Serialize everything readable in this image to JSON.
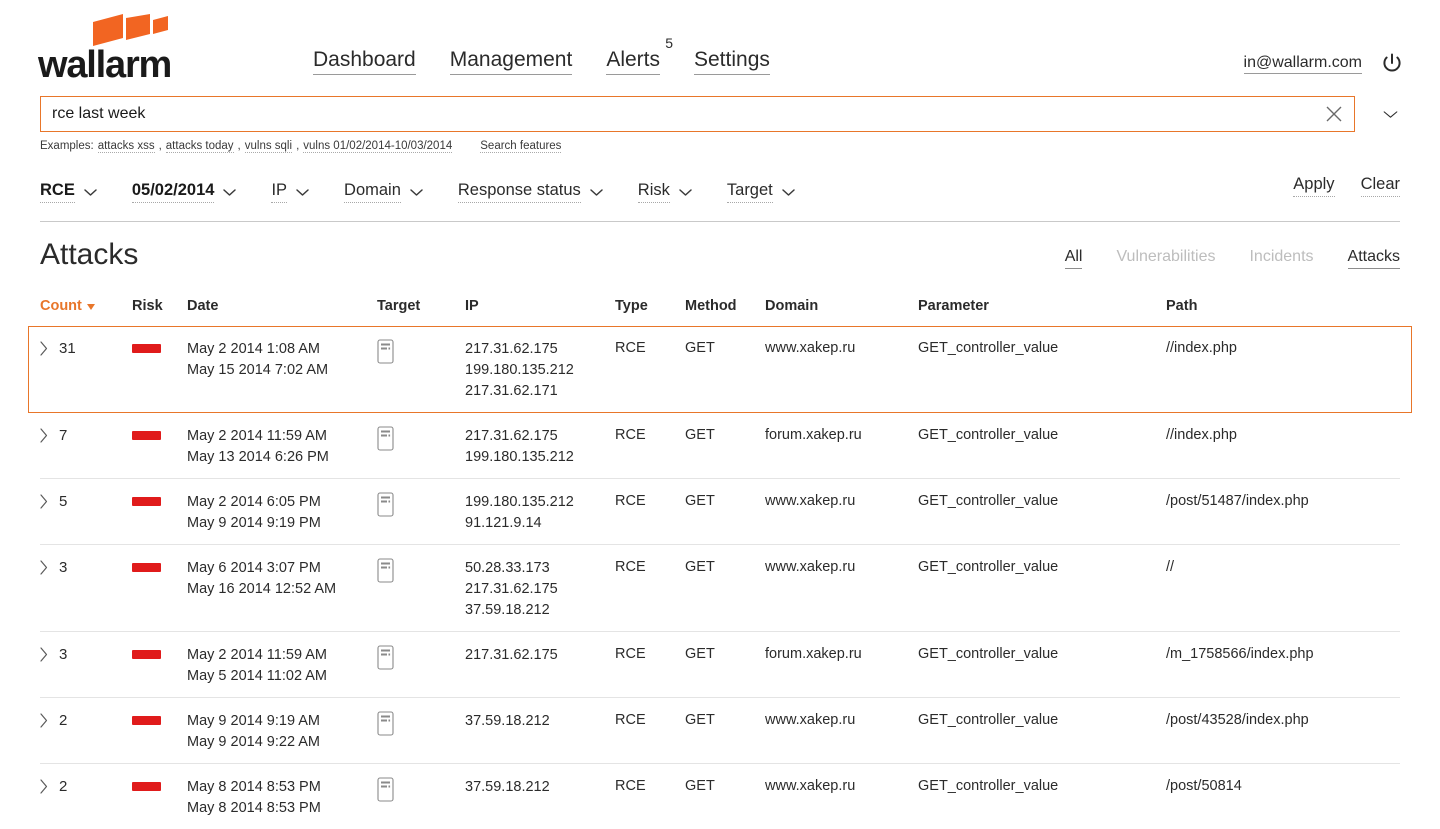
{
  "brand": {
    "name": "wallarm",
    "accent": "#f26522"
  },
  "nav": {
    "items": [
      {
        "label": "Dashboard",
        "badge": ""
      },
      {
        "label": "Management",
        "badge": ""
      },
      {
        "label": "Alerts",
        "badge": "5"
      },
      {
        "label": "Settings",
        "badge": ""
      }
    ]
  },
  "user": {
    "email": "in@wallarm.com",
    "logout_icon": "power-icon"
  },
  "search": {
    "value": "rce last week",
    "placeholder": "",
    "clear_icon": "close-icon",
    "expand_icon": "chevron-down-icon",
    "examples_label": "Examples:",
    "examples": [
      "attacks xss",
      "attacks today",
      "vulns sqli",
      "vulns 01/02/2014-10/03/2014"
    ],
    "features_link": "Search features"
  },
  "filters": {
    "items": [
      {
        "label": "RCE",
        "active": true
      },
      {
        "label": "05/02/2014",
        "active": true
      },
      {
        "label": "IP",
        "active": false
      },
      {
        "label": "Domain",
        "active": false
      },
      {
        "label": "Response status",
        "active": false
      },
      {
        "label": "Risk",
        "active": false
      },
      {
        "label": "Target",
        "active": false
      }
    ],
    "apply_label": "Apply",
    "clear_label": "Clear"
  },
  "section": {
    "title": "Attacks",
    "tabs": [
      {
        "label": "All",
        "state": "active"
      },
      {
        "label": "Vulnerabilities",
        "state": "disabled"
      },
      {
        "label": "Incidents",
        "state": "disabled"
      },
      {
        "label": "Attacks",
        "state": "active"
      }
    ]
  },
  "table": {
    "columns": [
      "Count",
      "Risk",
      "Date",
      "Target",
      "IP",
      "Type",
      "Method",
      "Domain",
      "Parameter",
      "Path"
    ],
    "sort": {
      "column": "Count",
      "direction": "desc",
      "color": "#e8762a"
    },
    "risk_color": "#e01b1b",
    "rows": [
      {
        "count": "31",
        "dates": [
          "May 2 2014 1:08 AM",
          "May 15 2014 7:02 AM"
        ],
        "ips": [
          "217.31.62.175",
          "199.180.135.212",
          "217.31.62.171"
        ],
        "type": "RCE",
        "method": "GET",
        "domain": "www.xakep.ru",
        "parameter": "GET_controller_value",
        "path": "//index.php",
        "selected": true
      },
      {
        "count": "7",
        "dates": [
          "May 2 2014 11:59 AM",
          "May 13 2014 6:26 PM"
        ],
        "ips": [
          "217.31.62.175",
          "199.180.135.212"
        ],
        "type": "RCE",
        "method": "GET",
        "domain": "forum.xakep.ru",
        "parameter": "GET_controller_value",
        "path": "//index.php",
        "selected": false
      },
      {
        "count": "5",
        "dates": [
          "May 2 2014 6:05 PM",
          "May 9 2014 9:19 PM"
        ],
        "ips": [
          "199.180.135.212",
          "91.121.9.14"
        ],
        "type": "RCE",
        "method": "GET",
        "domain": "www.xakep.ru",
        "parameter": "GET_controller_value",
        "path": "/post/51487/index.php",
        "selected": false
      },
      {
        "count": "3",
        "dates": [
          "May 6 2014 3:07 PM",
          "May 16 2014 12:52 AM"
        ],
        "ips": [
          "50.28.33.173",
          "217.31.62.175",
          "37.59.18.212"
        ],
        "type": "RCE",
        "method": "GET",
        "domain": "www.xakep.ru",
        "parameter": "GET_controller_value",
        "path": "//",
        "selected": false
      },
      {
        "count": "3",
        "dates": [
          "May 2 2014 11:59 AM",
          "May 5 2014 11:02 AM"
        ],
        "ips": [
          "217.31.62.175"
        ],
        "type": "RCE",
        "method": "GET",
        "domain": "forum.xakep.ru",
        "parameter": "GET_controller_value",
        "path": "/m_1758566/index.php",
        "selected": false
      },
      {
        "count": "2",
        "dates": [
          "May 9 2014 9:19 AM",
          "May 9 2014 9:22 AM"
        ],
        "ips": [
          "37.59.18.212"
        ],
        "type": "RCE",
        "method": "GET",
        "domain": "www.xakep.ru",
        "parameter": "GET_controller_value",
        "path": "/post/43528/index.php",
        "selected": false
      },
      {
        "count": "2",
        "dates": [
          "May 8 2014 8:53 PM",
          "May 8 2014 8:53 PM"
        ],
        "ips": [
          "37.59.18.212"
        ],
        "type": "RCE",
        "method": "GET",
        "domain": "www.xakep.ru",
        "parameter": "GET_controller_value",
        "path": "/post/50814",
        "selected": false
      }
    ]
  }
}
